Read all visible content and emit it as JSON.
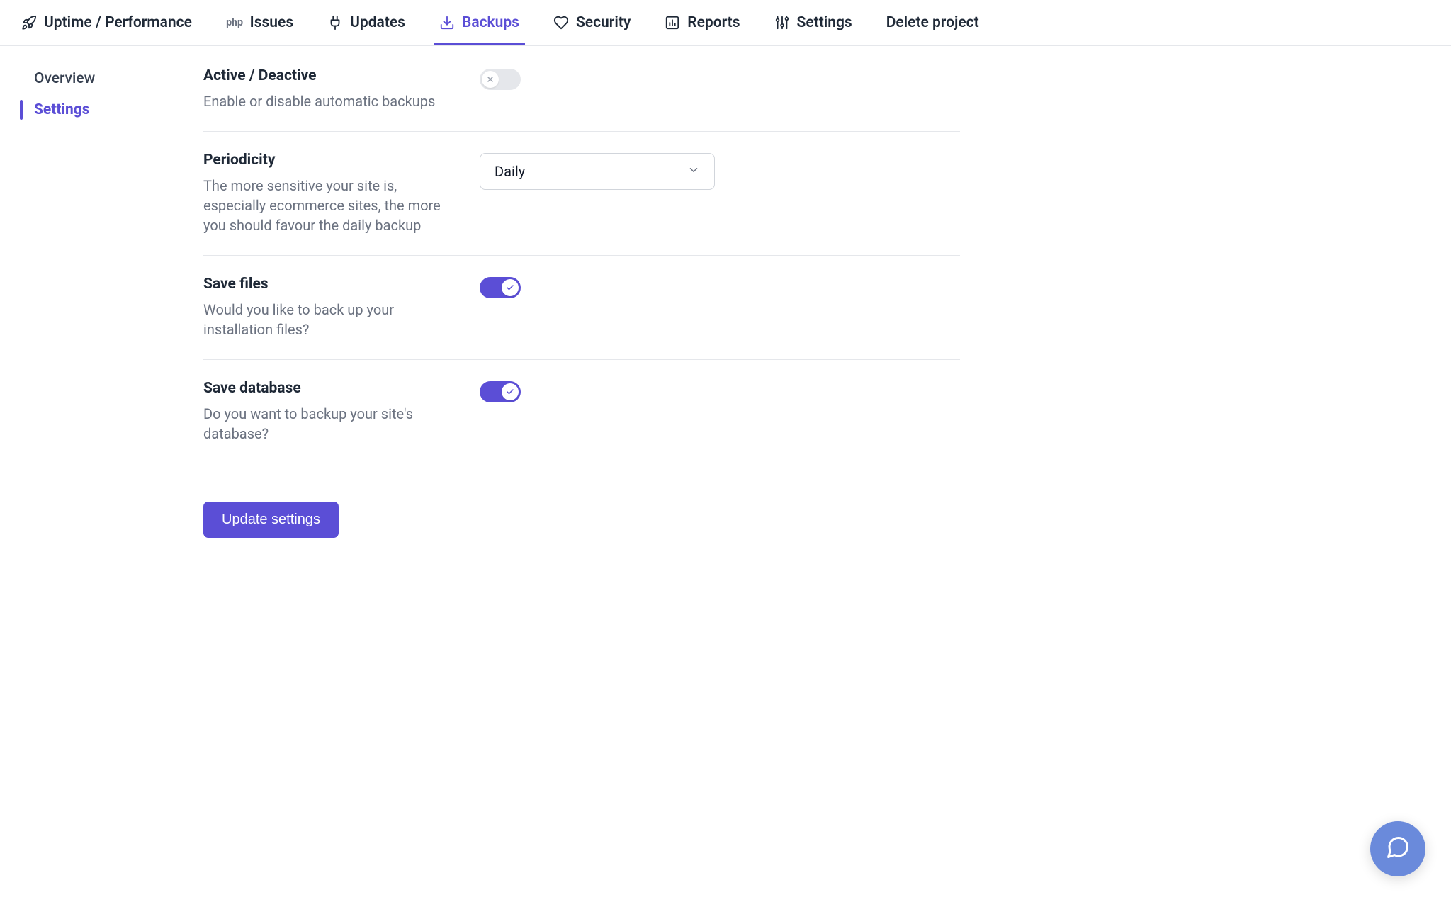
{
  "nav": {
    "uptime": "Uptime / Performance",
    "issues": "Issues",
    "updates": "Updates",
    "backups": "Backups",
    "security": "Security",
    "reports": "Reports",
    "settings": "Settings",
    "delete": "Delete project"
  },
  "sidebar": {
    "overview": "Overview",
    "settings": "Settings"
  },
  "settings": {
    "active": {
      "title": "Active / Deactive",
      "desc": "Enable or disable automatic backups"
    },
    "periodicity": {
      "title": "Periodicity",
      "desc": "The more sensitive your site is, especially ecommerce sites, the more you should favour the daily backup",
      "value": "Daily"
    },
    "save_files": {
      "title": "Save files",
      "desc": "Would you like to back up your installation files?"
    },
    "save_db": {
      "title": "Save database",
      "desc": "Do you want to backup your site's database?"
    }
  },
  "actions": {
    "update": "Update settings"
  }
}
